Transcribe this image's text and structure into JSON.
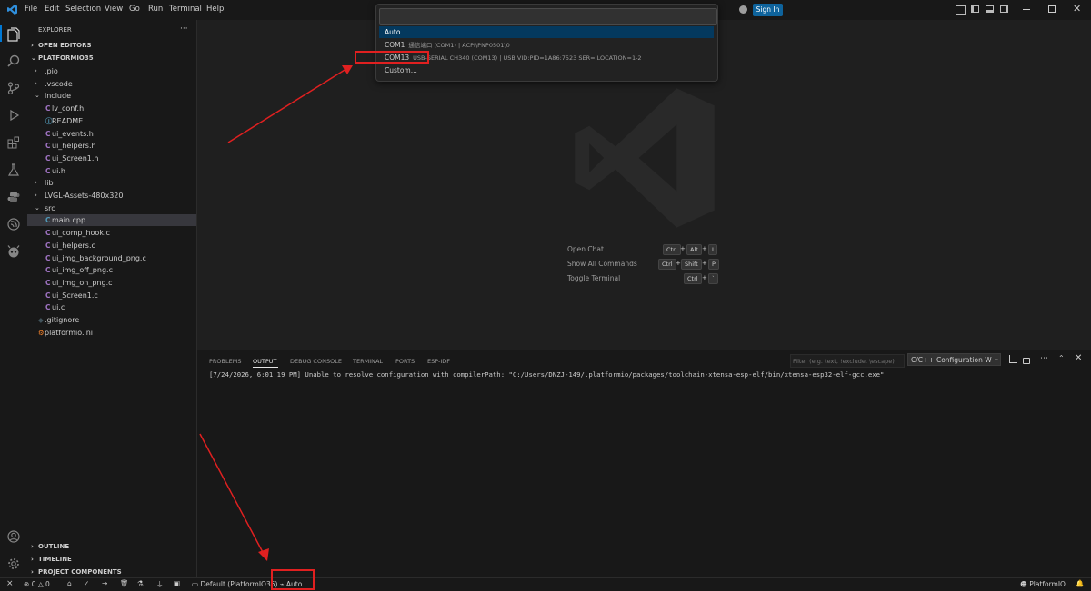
{
  "titlebar": {
    "menus": [
      "File",
      "Edit",
      "Selection",
      "View",
      "Go",
      "Run",
      "Terminal",
      "Help"
    ],
    "sign_in": "Sign In"
  },
  "explorer": {
    "title": "EXPLORER",
    "more": "···",
    "open_editors": "OPEN EDITORS",
    "project": "PLATFORMIO35",
    "items": [
      {
        "label": ".pio",
        "kind": "folder-closed",
        "depth": 0
      },
      {
        "label": ".vscode",
        "kind": "folder-closed",
        "depth": 0
      },
      {
        "label": "include",
        "kind": "folder-open",
        "depth": 0
      },
      {
        "label": "lv_conf.h",
        "kind": "c",
        "depth": 1
      },
      {
        "label": "README",
        "kind": "info",
        "depth": 1
      },
      {
        "label": "ui_events.h",
        "kind": "c",
        "depth": 1
      },
      {
        "label": "ui_helpers.h",
        "kind": "c",
        "depth": 1
      },
      {
        "label": "ui_Screen1.h",
        "kind": "c",
        "depth": 1
      },
      {
        "label": "ui.h",
        "kind": "c",
        "depth": 1
      },
      {
        "label": "lib",
        "kind": "folder-closed",
        "depth": 0
      },
      {
        "label": "LVGL-Assets-480x320",
        "kind": "folder-closed",
        "depth": 0
      },
      {
        "label": "src",
        "kind": "folder-open",
        "depth": 0
      },
      {
        "label": "main.cpp",
        "kind": "cpp",
        "depth": 1,
        "selected": true
      },
      {
        "label": "ui_comp_hook.c",
        "kind": "c",
        "depth": 1
      },
      {
        "label": "ui_helpers.c",
        "kind": "c",
        "depth": 1
      },
      {
        "label": "ui_img_background_png.c",
        "kind": "c",
        "depth": 1
      },
      {
        "label": "ui_img_off_png.c",
        "kind": "c",
        "depth": 1
      },
      {
        "label": "ui_img_on_png.c",
        "kind": "c",
        "depth": 1
      },
      {
        "label": "ui_Screen1.c",
        "kind": "c",
        "depth": 1
      },
      {
        "label": "ui.c",
        "kind": "c",
        "depth": 1
      },
      {
        "label": ".gitignore",
        "kind": "git",
        "depth": 0
      },
      {
        "label": "platformio.ini",
        "kind": "pio",
        "depth": 0
      }
    ],
    "outline": "OUTLINE",
    "timeline": "TIMELINE",
    "project_components": "PROJECT COMPONENTS"
  },
  "quickpick": {
    "input_value": "",
    "items": [
      {
        "label": "Auto",
        "desc": "",
        "active": true
      },
      {
        "label": "COM1",
        "desc": "通信端口 (COM1) | ACPI\\PNP0501\\0"
      },
      {
        "label": "COM13",
        "desc": "USB-SERIAL CH340 (COM13) | USB VID:PID=1A86:7523 SER= LOCATION=1-2"
      },
      {
        "label": "Custom...",
        "desc": ""
      }
    ]
  },
  "shortcuts": [
    {
      "label": "Open Chat",
      "keys": [
        "Ctrl",
        "Alt",
        "I"
      ]
    },
    {
      "label": "Show All Commands",
      "keys": [
        "Ctrl",
        "Shift",
        "P"
      ]
    },
    {
      "label": "Toggle Terminal",
      "keys": [
        "Ctrl",
        "`"
      ]
    }
  ],
  "panel": {
    "tabs": [
      "PROBLEMS",
      "OUTPUT",
      "DEBUG CONSOLE",
      "TERMINAL",
      "PORTS",
      "ESP-IDF"
    ],
    "active_tab": "OUTPUT",
    "filter_placeholder": "Filter (e.g. text, !exclude, \\escape)",
    "channel": "C/C++ Configuration W",
    "output_line": "[7/24/2026, 6:01:19 PM] Unable to resolve configuration with compilerPath: \"C:/Users/DNZJ-149/.platformio/packages/toolchain-xtensa-esp-elf/bin/xtensa-esp32-elf-gcc.exe\""
  },
  "statusbar": {
    "errors": "0",
    "warnings": "0",
    "env": "Default (PlatformIO35)",
    "port": "Auto",
    "right_label": "PlatformIO"
  },
  "colors": {
    "accent": "#0e639c",
    "active_item": "#04395e",
    "annotation": "#e02020",
    "c_icon": "#a074c4",
    "info_icon": "#519aba"
  }
}
